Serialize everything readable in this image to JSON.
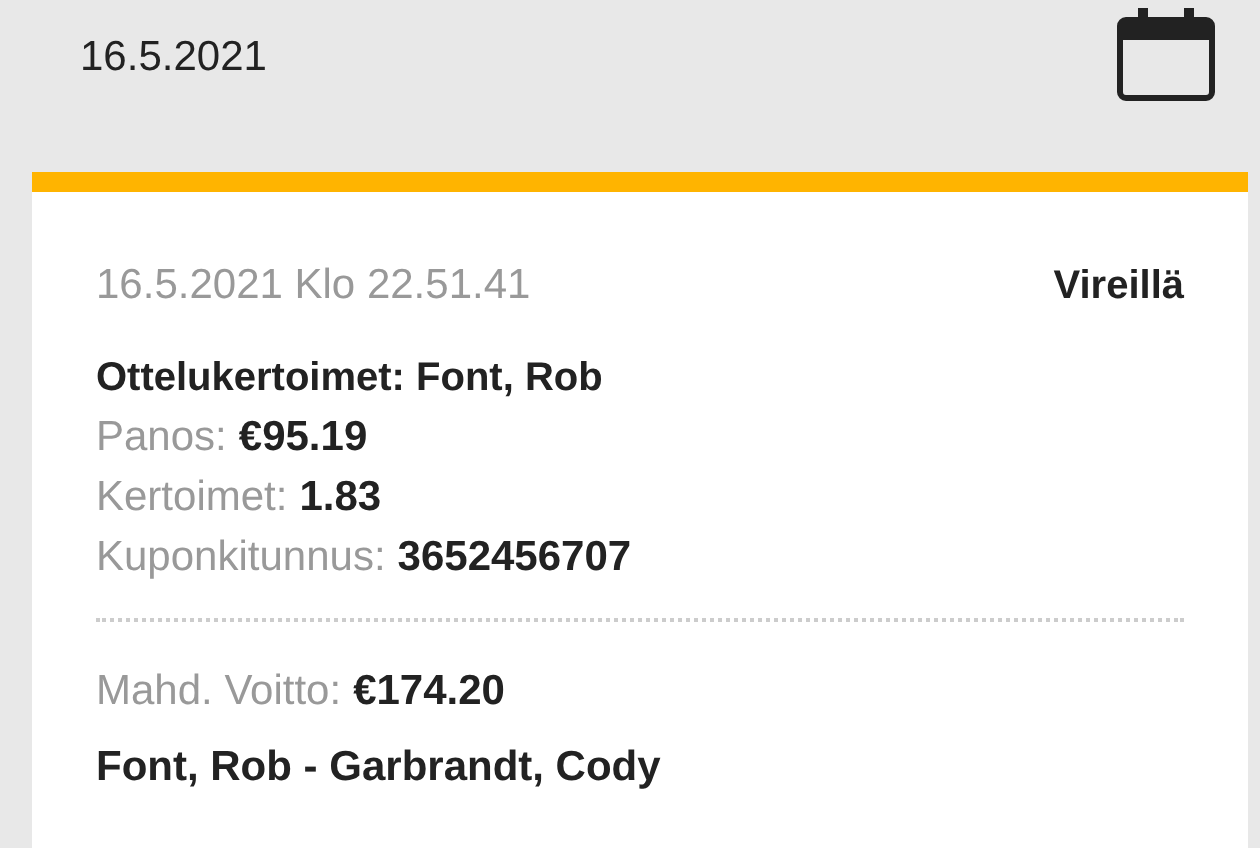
{
  "header": {
    "date": "16.5.2021"
  },
  "bet": {
    "timestamp": "16.5.2021 Klo 22.51.41",
    "status": "Vireillä",
    "title": "Ottelukertoimet: Font, Rob",
    "details": [
      {
        "label": "Panos:",
        "value": "€95.19"
      },
      {
        "label": "Kertoimet:",
        "value": "1.83"
      },
      {
        "label": "Kuponkitunnus:",
        "value": "3652456707"
      }
    ],
    "potential_win": {
      "label": "Mahd. Voitto:",
      "value": "€174.20"
    },
    "match": "Font, Rob - Garbrandt, Cody"
  }
}
